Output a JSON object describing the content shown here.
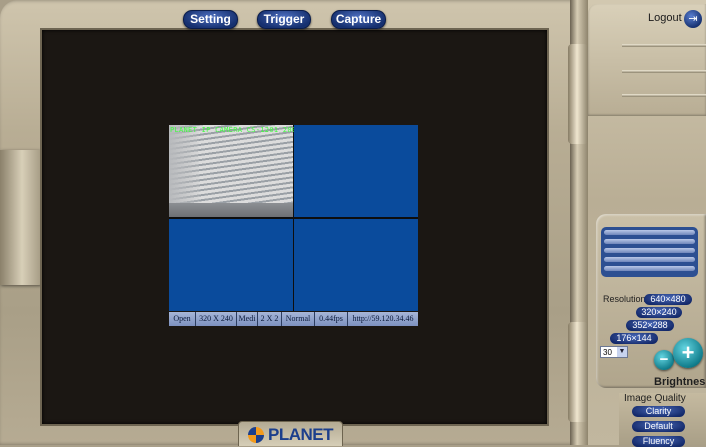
{
  "top_menu": {
    "setting_label": "Setting",
    "trigger_label": "Trigger",
    "capture_label": "Capture"
  },
  "header": {
    "logout_label": "Logout",
    "logout_icon": "exit-door-icon"
  },
  "video": {
    "camera_overlay_text": "PLANET IP CAMERA CS-1201 2008/01/01",
    "status_bar": [
      "Open",
      "320 X 240",
      "Medi",
      "2 X 2",
      "Normal",
      "0.44fps",
      "http://59.120.34.46"
    ]
  },
  "logo": {
    "text": "PLANET"
  },
  "controls": {
    "resolution_label": "Resolution",
    "resolutions": [
      "640×480",
      "320×240",
      "352×288",
      "176×144"
    ],
    "fps_value": "30",
    "brightness_label": "Brightness",
    "brightness_minus": "−",
    "brightness_plus": "+",
    "image_quality_label": "Image Quality",
    "quality_options": [
      "Clarity",
      "Default",
      "Fluency"
    ]
  },
  "colors": {
    "video_background": "#1b1713",
    "empty_channel": "#0a4b9c",
    "button_blue": "#16306f",
    "overlay_green": "#3dff3d"
  }
}
